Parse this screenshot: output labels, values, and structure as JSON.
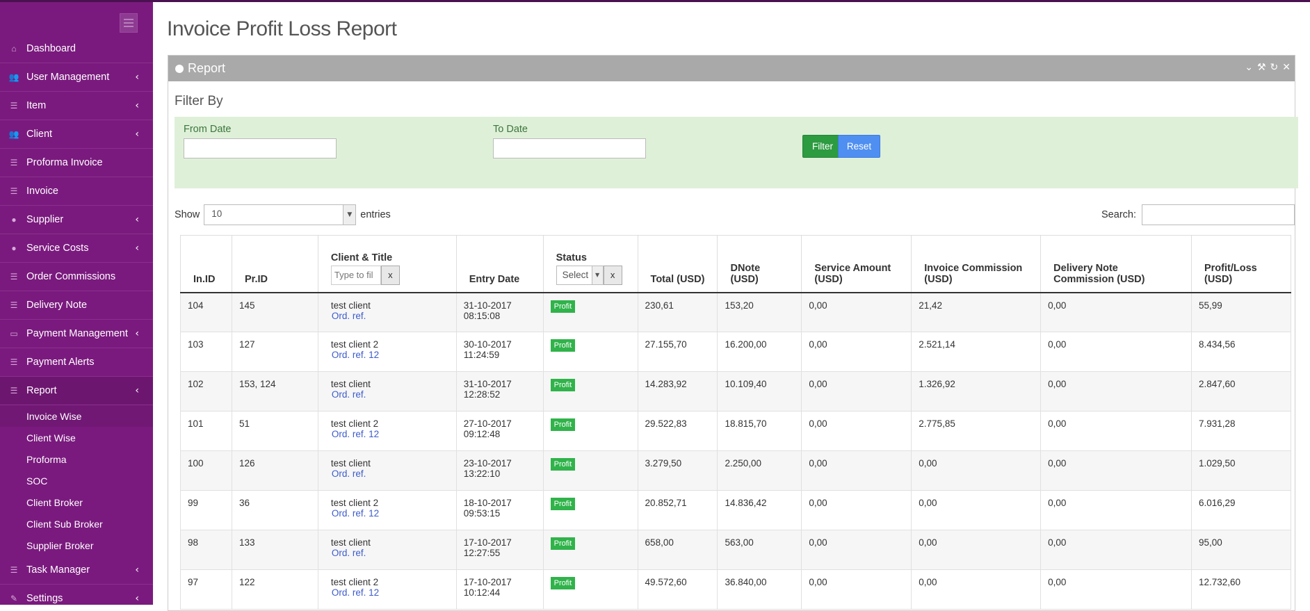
{
  "sidebar": {
    "items": [
      {
        "label": "Dashboard",
        "icon": "home-icon",
        "chevron": ""
      },
      {
        "label": "User Management",
        "icon": "users-icon",
        "chevron": "‹"
      },
      {
        "label": "Item",
        "icon": "list-icon",
        "chevron": "‹"
      },
      {
        "label": "Client",
        "icon": "users-icon",
        "chevron": "‹"
      },
      {
        "label": "Proforma Invoice",
        "icon": "list-icon",
        "chevron": ""
      },
      {
        "label": "Invoice",
        "icon": "list-icon",
        "chevron": ""
      },
      {
        "label": "Supplier",
        "icon": "user-icon",
        "chevron": "‹"
      },
      {
        "label": "Service Costs",
        "icon": "user-icon",
        "chevron": "‹"
      },
      {
        "label": "Order Commissions",
        "icon": "list-icon",
        "chevron": ""
      },
      {
        "label": "Delivery Note",
        "icon": "list-icon",
        "chevron": ""
      },
      {
        "label": "Payment Management",
        "icon": "money-icon",
        "chevron": "‹"
      },
      {
        "label": "Payment Alerts",
        "icon": "list-icon",
        "chevron": ""
      },
      {
        "label": "Report",
        "icon": "list-icon",
        "chevron": "‹"
      }
    ],
    "report_submenu": [
      "Invoice Wise",
      "Client Wise",
      "Proforma",
      "SOC",
      "Client Broker",
      "Client Sub Broker",
      "Supplier Broker"
    ],
    "items_after": [
      {
        "label": "Task Manager",
        "icon": "list-icon",
        "chevron": "‹"
      },
      {
        "label": "Settings",
        "icon": "wrench-icon",
        "chevron": "‹"
      }
    ]
  },
  "page": {
    "title": "Invoice Profit Loss Report",
    "panel_title": "Report",
    "filter_by": "Filter By",
    "from_date_label": "From Date",
    "to_date_label": "To Date",
    "filter_button": "Filter",
    "reset_button": "Reset",
    "show_label": "Show",
    "entries_value": "10",
    "entries_label": "entries",
    "search_label": "Search:"
  },
  "table": {
    "headers": [
      "In.ID",
      "Pr.ID",
      "Client & Title",
      "Entry Date",
      "Status",
      "Total (USD)",
      "DNote (USD)",
      "Service Amount (USD)",
      "Invoice Commission (USD)",
      "Delivery Note Commission (USD)",
      "Profit/Loss (USD)"
    ],
    "client_filter_placeholder": "Type to fil",
    "status_filter_value": "Select",
    "clear_label": "x",
    "rows": [
      {
        "in_id": "104",
        "pr_id": "145",
        "client": "test client",
        "ref": "Ord. ref.",
        "date": "31-10-2017",
        "time": "08:15:08",
        "status": "Profit",
        "total": "230,61",
        "dnote": "153,20",
        "service": "0,00",
        "inv_comm": "21,42",
        "dn_comm": "0,00",
        "pl": "55,99"
      },
      {
        "in_id": "103",
        "pr_id": "127",
        "client": "test client 2",
        "ref": "Ord. ref. 12",
        "date": "30-10-2017",
        "time": "11:24:59",
        "status": "Profit",
        "total": "27.155,70",
        "dnote": "16.200,00",
        "service": "0,00",
        "inv_comm": "2.521,14",
        "dn_comm": "0,00",
        "pl": "8.434,56"
      },
      {
        "in_id": "102",
        "pr_id": "153, 124",
        "client": "test client",
        "ref": "Ord. ref.",
        "date": "31-10-2017",
        "time": "12:28:52",
        "status": "Profit",
        "total": "14.283,92",
        "dnote": "10.109,40",
        "service": "0,00",
        "inv_comm": "1.326,92",
        "dn_comm": "0,00",
        "pl": "2.847,60"
      },
      {
        "in_id": "101",
        "pr_id": "51",
        "client": "test client 2",
        "ref": "Ord. ref. 12",
        "date": "27-10-2017",
        "time": "09:12:48",
        "status": "Profit",
        "total": "29.522,83",
        "dnote": "18.815,70",
        "service": "0,00",
        "inv_comm": "2.775,85",
        "dn_comm": "0,00",
        "pl": "7.931,28"
      },
      {
        "in_id": "100",
        "pr_id": "126",
        "client": "test client",
        "ref": "Ord. ref.",
        "date": "23-10-2017",
        "time": "13:22:10",
        "status": "Profit",
        "total": "3.279,50",
        "dnote": "2.250,00",
        "service": "0,00",
        "inv_comm": "0,00",
        "dn_comm": "0,00",
        "pl": "1.029,50"
      },
      {
        "in_id": "99",
        "pr_id": "36",
        "client": "test client 2",
        "ref": "Ord. ref. 12",
        "date": "18-10-2017",
        "time": "09:53:15",
        "status": "Profit",
        "total": "20.852,71",
        "dnote": "14.836,42",
        "service": "0,00",
        "inv_comm": "0,00",
        "dn_comm": "0,00",
        "pl": "6.016,29"
      },
      {
        "in_id": "98",
        "pr_id": "133",
        "client": "test client",
        "ref": "Ord. ref.",
        "date": "17-10-2017",
        "time": "12:27:55",
        "status": "Profit",
        "total": "658,00",
        "dnote": "563,00",
        "service": "0,00",
        "inv_comm": "0,00",
        "dn_comm": "0,00",
        "pl": "95,00"
      },
      {
        "in_id": "97",
        "pr_id": "122",
        "client": "test client 2",
        "ref": "Ord. ref. 12",
        "date": "17-10-2017",
        "time": "10:12:44",
        "status": "Profit",
        "total": "49.572,60",
        "dnote": "36.840,00",
        "service": "0,00",
        "inv_comm": "0,00",
        "dn_comm": "0,00",
        "pl": "12.732,60"
      }
    ]
  },
  "colors": {
    "sidebar": "#7a1a7e",
    "filter_bg": "#dff0d8",
    "profit": "#30b34a",
    "filter_btn": "#2d9b40",
    "reset_btn": "#4f8ff1"
  }
}
